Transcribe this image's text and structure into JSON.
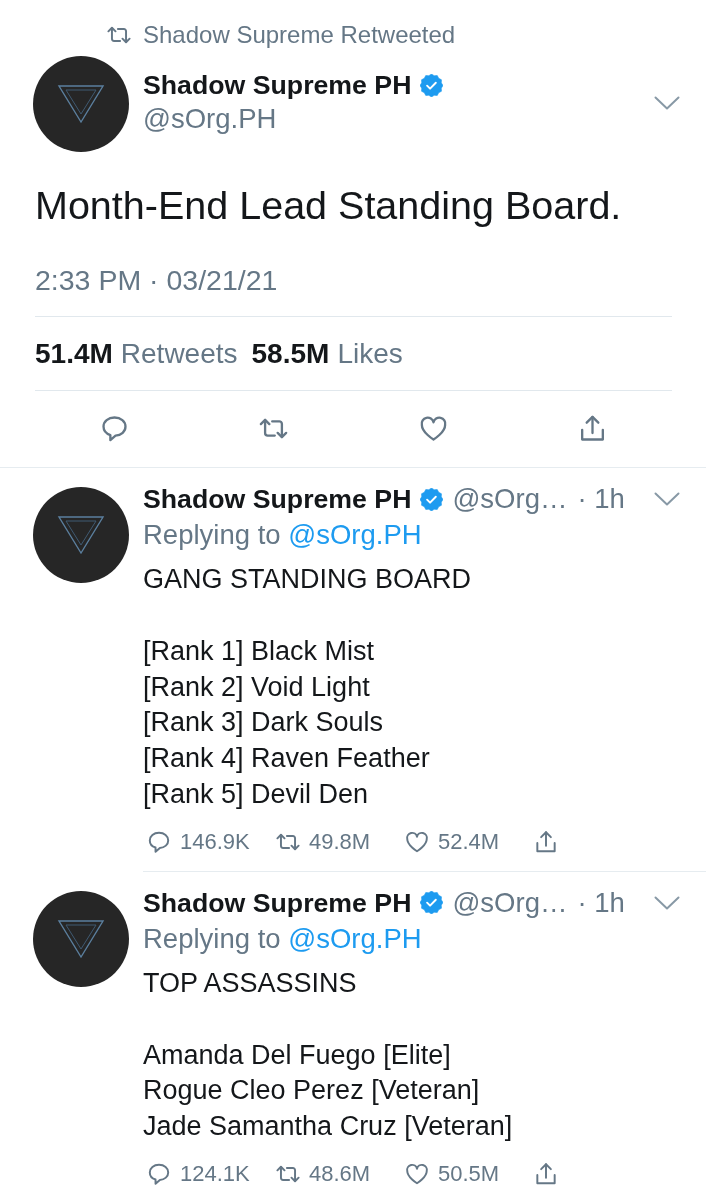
{
  "social_context": {
    "text": "Shadow Supreme Retweeted"
  },
  "main_tweet": {
    "author": {
      "name": "Shadow Supreme PH",
      "verified": true,
      "handle": "@sOrg.PH"
    },
    "text": "Month-End Lead Standing Board.",
    "timestamp": "2:33 PM · 03/21/21",
    "stats": [
      {
        "count": "51.4M",
        "label": "Retweets"
      },
      {
        "count": "58.5M",
        "label": "Likes"
      }
    ],
    "actions": [
      {
        "kind": "reply"
      },
      {
        "kind": "retweet"
      },
      {
        "kind": "like"
      },
      {
        "kind": "share"
      }
    ]
  },
  "replies": [
    {
      "author": {
        "name": "Shadow Supreme PH",
        "verified": true,
        "handle": "@sOrg…"
      },
      "time": "· 1h",
      "replying_to": {
        "prefix": "Replying to",
        "handle": "@sOrg.PH"
      },
      "heading": "GANG STANDING BOARD",
      "lines": [
        "[Rank 1] Black Mist",
        "[Rank 2] Void Light",
        "[Rank 3] Dark Souls",
        "[Rank 4] Raven Feather",
        "[Rank 5] Devil Den"
      ],
      "actions": [
        {
          "kind": "reply",
          "count": "146.9K"
        },
        {
          "kind": "retweet",
          "count": "49.8M"
        },
        {
          "kind": "like",
          "count": "52.4M"
        },
        {
          "kind": "share"
        }
      ]
    },
    {
      "author": {
        "name": "Shadow Supreme PH",
        "verified": true,
        "handle": "@sOrg…"
      },
      "time": "· 1h",
      "replying_to": {
        "prefix": "Replying to",
        "handle": "@sOrg.PH"
      },
      "heading": "TOP ASSASSINS",
      "lines": [
        "Amanda Del Fuego [Elite]",
        "Rogue Cleo Perez [Veteran]",
        "Jade Samantha Cruz [Veteran]"
      ],
      "actions": [
        {
          "kind": "reply",
          "count": "124.1K"
        },
        {
          "kind": "retweet",
          "count": "48.6M"
        },
        {
          "kind": "like",
          "count": "50.5M"
        },
        {
          "kind": "share"
        }
      ]
    }
  ]
}
